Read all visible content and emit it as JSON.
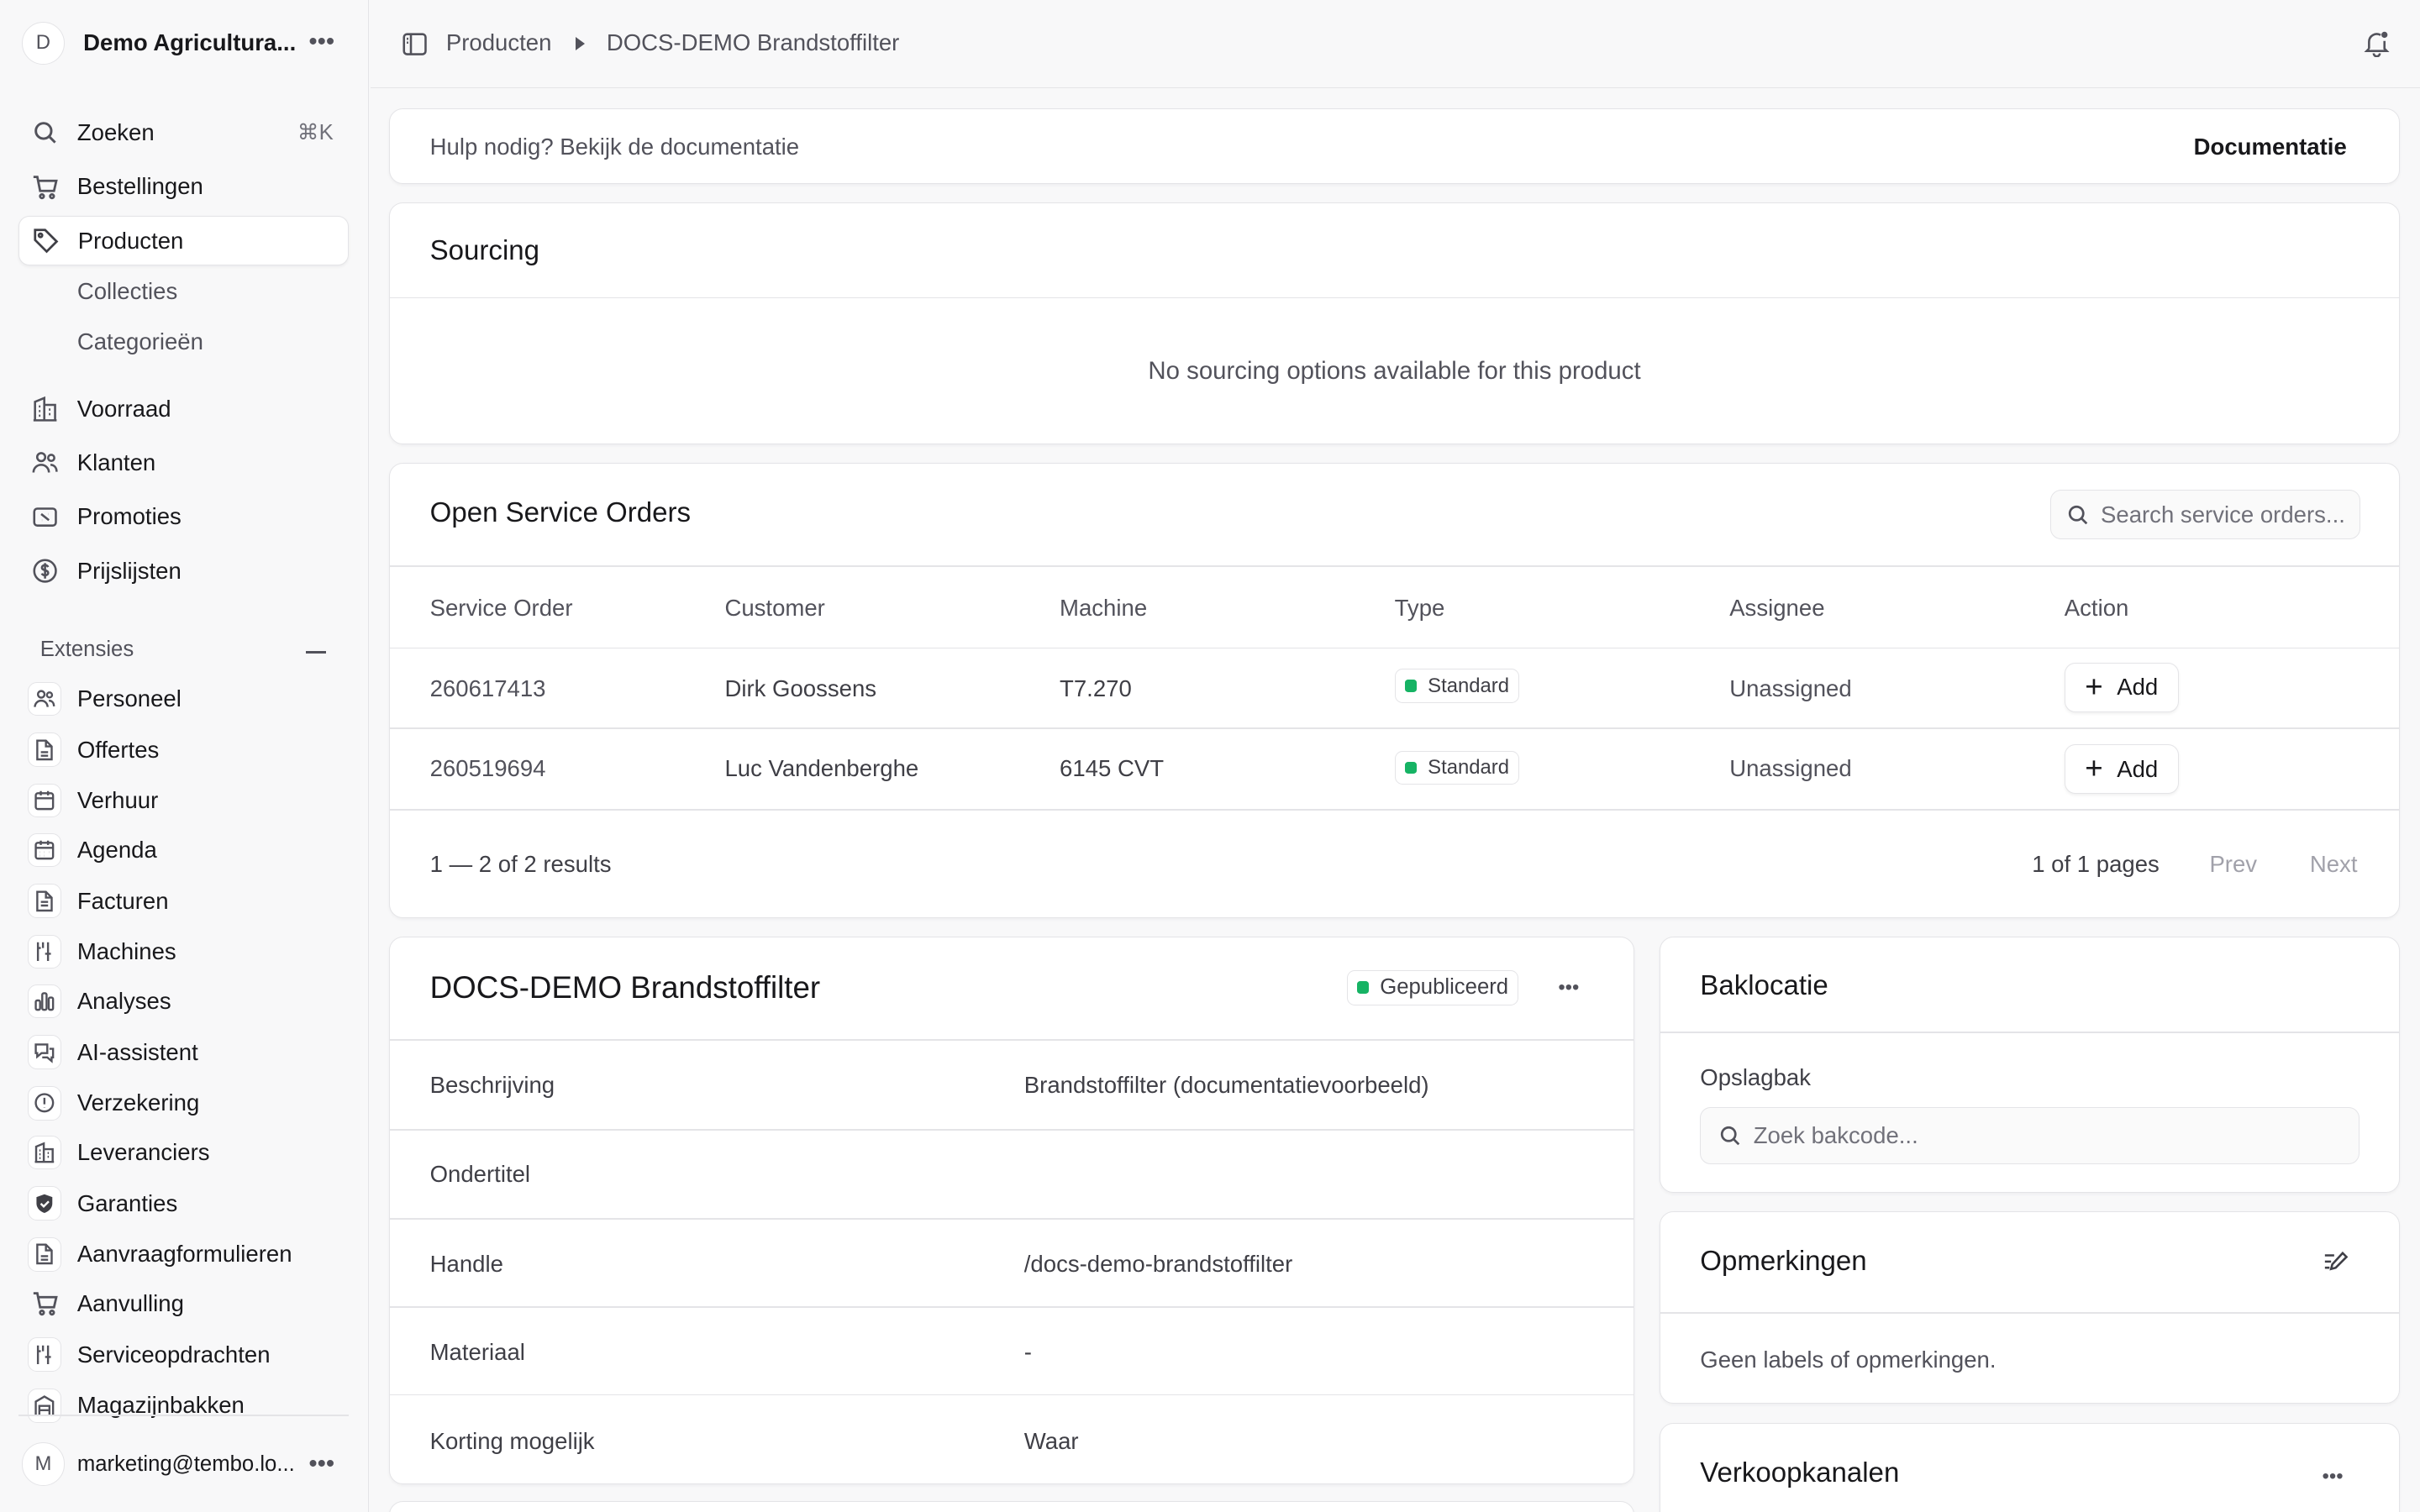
{
  "sidebar": {
    "brand_initial": "D",
    "brand_name": "Demo Agricultura...",
    "search_label": "Zoeken",
    "search_shortcut": "⌘K",
    "nav": {
      "orders": "Bestellingen",
      "products": "Producten",
      "collections": "Collecties",
      "categories": "Categorieën",
      "inventory": "Voorraad",
      "customers": "Klanten",
      "promotions": "Promoties",
      "pricelists": "Prijslijsten"
    },
    "extensions_title": "Extensies",
    "extensions": [
      "Personeel",
      "Offertes",
      "Verhuur",
      "Agenda",
      "Facturen",
      "Machines",
      "Analyses",
      "AI-assistent",
      "Verzekering",
      "Leveranciers",
      "Garanties",
      "Aanvraagformulieren",
      "Aanvulling",
      "Serviceopdrachten",
      "Magazijnbakken"
    ],
    "user_initial": "M",
    "user_email": "marketing@tembo.lo..."
  },
  "topbar": {
    "crumb_parent": "Producten",
    "crumb_current": "DOCS-DEMO Brandstoffilter"
  },
  "help": {
    "text": "Hulp nodig? Bekijk de documentatie",
    "link": "Documentatie"
  },
  "sourcing": {
    "title": "Sourcing",
    "empty": "No sourcing options available for this product"
  },
  "service_orders": {
    "title": "Open Service Orders",
    "search_placeholder": "Search service orders...",
    "columns": [
      "Service Order",
      "Customer",
      "Machine",
      "Type",
      "Assignee",
      "Action"
    ],
    "rows": [
      {
        "order": "260617413",
        "customer": "Dirk Goossens",
        "machine": "T7.270",
        "type": "Standard",
        "assignee": "Unassigned",
        "action": "Add"
      },
      {
        "order": "260519694",
        "customer": "Luc Vandenberghe",
        "machine": "6145 CVT",
        "type": "Standard",
        "assignee": "Unassigned",
        "action": "Add"
      }
    ],
    "results": "1 — 2 of 2 results",
    "pages": "1 of 1 pages",
    "prev": "Prev",
    "next": "Next"
  },
  "product": {
    "title": "DOCS-DEMO Brandstoffilter",
    "status": "Gepubliceerd",
    "rows": [
      {
        "label": "Beschrijving",
        "value": "Brandstoffilter (documentatievoorbeeld)"
      },
      {
        "label": "Ondertitel",
        "value": ""
      },
      {
        "label": "Handle",
        "value": "/docs-demo-brandstoffilter"
      },
      {
        "label": "Materiaal",
        "value": "-"
      },
      {
        "label": "Korting mogelijk",
        "value": "Waar"
      }
    ]
  },
  "bin": {
    "title": "Baklocatie",
    "label": "Opslagbak",
    "placeholder": "Zoek bakcode..."
  },
  "notes": {
    "title": "Opmerkingen",
    "empty": "Geen labels of opmerkingen."
  },
  "channels": {
    "title": "Verkoopkanalen"
  },
  "colors": {
    "accent_green": "#16b364",
    "border": "#e4e4e7",
    "text": "#18181b",
    "muted": "#52525b"
  }
}
